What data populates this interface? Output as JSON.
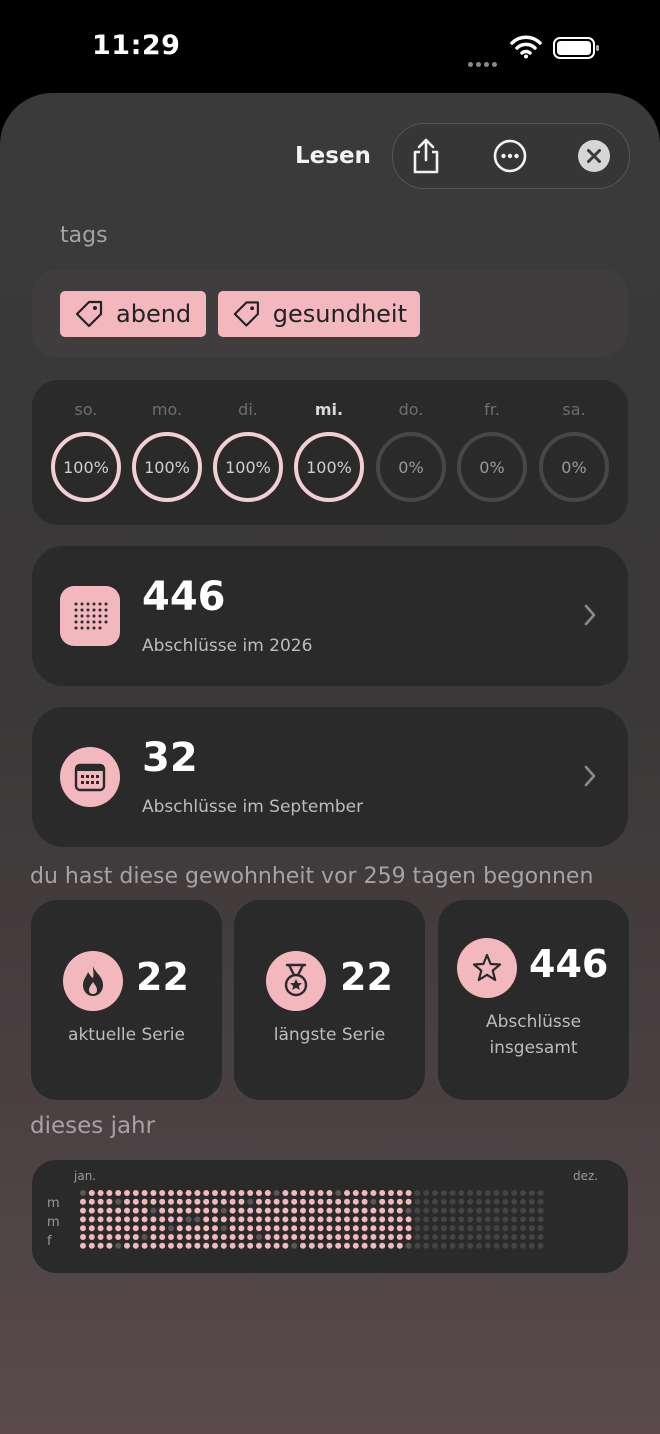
{
  "status_bar": {
    "time": "11:29"
  },
  "header": {
    "title": "Lesen"
  },
  "tags_section": {
    "label": "tags",
    "tags": [
      {
        "label": "abend"
      },
      {
        "label": "gesundheit"
      }
    ]
  },
  "week": {
    "days": [
      {
        "label": "so.",
        "value": "100%",
        "done": true
      },
      {
        "label": "mo.",
        "value": "100%",
        "done": true
      },
      {
        "label": "di.",
        "value": "100%",
        "done": true
      },
      {
        "label": "mi.",
        "value": "100%",
        "done": true,
        "today": true
      },
      {
        "label": "do.",
        "value": "0%",
        "done": false
      },
      {
        "label": "fr.",
        "value": "0%",
        "done": false
      },
      {
        "label": "sa.",
        "value": "0%",
        "done": false
      }
    ]
  },
  "year_stat": {
    "value": "446",
    "label": "Abschlüsse im 2026"
  },
  "month_stat": {
    "value": "32",
    "label": "Abschlüsse im September"
  },
  "since_text": "du hast diese gewohnheit vor 259 tagen begonnen",
  "streaks": {
    "current": {
      "value": "22",
      "label": "aktuelle Serie"
    },
    "longest": {
      "value": "22",
      "label": "längste Serie"
    },
    "total": {
      "value": "446",
      "label_line1": "Abschlüsse",
      "label_line2": "insgesamt"
    }
  },
  "year_section": {
    "label": "dieses jahr",
    "month_start": "jan.",
    "month_end": "dez.",
    "day_labels": [
      "m",
      "m",
      "f"
    ]
  },
  "colors": {
    "accent": "#f2b8bd",
    "card": "#2a2a2a",
    "ring_done": "#f2cfd2",
    "ring_empty": "#474747"
  },
  "icons": {
    "share": "share-icon",
    "more": "ellipsis-circle-icon",
    "close": "close-icon",
    "tag": "tag-icon",
    "year_grid": "dot-grid-icon",
    "calendar": "calendar-icon",
    "flame": "flame-icon",
    "medal": "medal-icon",
    "star": "star-icon",
    "chevron": "chevron-right-icon"
  }
}
